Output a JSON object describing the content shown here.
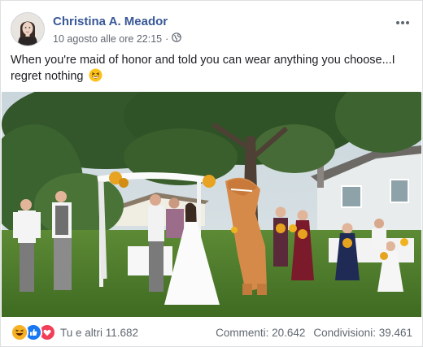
{
  "post": {
    "author": "Christina A. Meador",
    "timestamp": "10 agosto alle ore 22:15",
    "privacy_icon": "globe-icon",
    "more_icon": "ellipsis-icon",
    "text": "When you're maid of honor and told you can wear anything you choose...I regret nothing",
    "text_emoji": "grinning-squinting-face-emoji"
  },
  "footer": {
    "reaction_icons": [
      "haha-reaction-icon",
      "like-reaction-icon",
      "love-reaction-icon"
    ],
    "reactions_label": "Tu e altri 11.682",
    "comments_label": "Commenti: 20.642",
    "shares_label": "Condivisioni: 39.461"
  },
  "colors": {
    "author_link": "#385898",
    "meta_text": "#616770",
    "like_blue": "#1877f2",
    "love_red": "#f33e58",
    "haha_yellow": "#f7b125"
  }
}
